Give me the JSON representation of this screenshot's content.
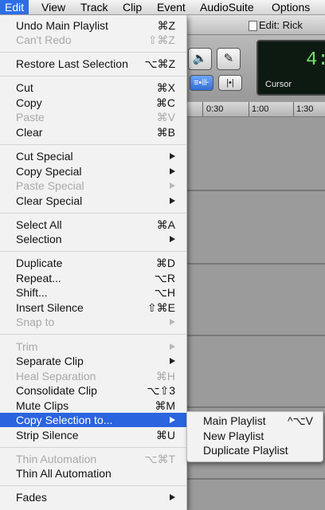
{
  "menubar": {
    "items": [
      {
        "label": "Edit",
        "active": true
      },
      {
        "label": "View"
      },
      {
        "label": "Track"
      },
      {
        "label": "Clip"
      },
      {
        "label": "Event"
      },
      {
        "label": "AudioSuite"
      },
      {
        "label": "Options"
      }
    ]
  },
  "window": {
    "title": "Edit: Rick",
    "counter_value": "4:",
    "counter_label": "Cursor",
    "ruler_ticks": [
      "0:30",
      "1:00",
      "1:30"
    ]
  },
  "edit_menu": {
    "items": [
      {
        "label": "Undo Main Playlist",
        "shortcut": "⌘Z"
      },
      {
        "label": "Can't Redo",
        "shortcut": "⇧⌘Z",
        "disabled": true
      },
      {
        "label": "Restore Last Selection",
        "shortcut": "⌥⌘Z"
      },
      {
        "label": "Cut",
        "shortcut": "⌘X"
      },
      {
        "label": "Copy",
        "shortcut": "⌘C"
      },
      {
        "label": "Paste",
        "shortcut": "⌘V",
        "disabled": true
      },
      {
        "label": "Clear",
        "shortcut": "⌘B"
      },
      {
        "label": "Cut Special",
        "submenu": true
      },
      {
        "label": "Copy Special",
        "submenu": true
      },
      {
        "label": "Paste Special",
        "submenu": true,
        "disabled": true
      },
      {
        "label": "Clear Special",
        "submenu": true
      },
      {
        "label": "Select All",
        "shortcut": "⌘A"
      },
      {
        "label": "Selection",
        "submenu": true
      },
      {
        "label": "Duplicate",
        "shortcut": "⌘D"
      },
      {
        "label": "Repeat...",
        "shortcut": "⌥R"
      },
      {
        "label": "Shift...",
        "shortcut": "⌥H"
      },
      {
        "label": "Insert Silence",
        "shortcut": "⇧⌘E"
      },
      {
        "label": "Snap to",
        "submenu": true,
        "disabled": true
      },
      {
        "label": "Trim",
        "submenu": true,
        "disabled": true
      },
      {
        "label": "Separate Clip",
        "submenu": true
      },
      {
        "label": "Heal Separation",
        "shortcut": "⌘H",
        "disabled": true
      },
      {
        "label": "Consolidate Clip",
        "shortcut": "⌥⇧3"
      },
      {
        "label": "Mute Clips",
        "shortcut": "⌘M"
      },
      {
        "label": "Copy Selection to...",
        "submenu": true,
        "highlighted": true
      },
      {
        "label": "Strip Silence",
        "shortcut": "⌘U"
      },
      {
        "label": "Thin Automation",
        "shortcut": "⌥⌘T",
        "disabled": true
      },
      {
        "label": "Thin All Automation",
        "shortcut": ""
      },
      {
        "label": "Fades",
        "submenu": true
      }
    ]
  },
  "submenu": {
    "items": [
      {
        "label": "Main Playlist",
        "shortcut": "^⌥V"
      },
      {
        "label": "New Playlist",
        "shortcut": ""
      },
      {
        "label": "Duplicate Playlist",
        "shortcut": ""
      }
    ]
  },
  "colors": {
    "highlight": "#2a64de",
    "menu_bg": "#f2f2f2",
    "disabled_text": "#a8a8a8",
    "counter_text": "#6fe36b"
  }
}
